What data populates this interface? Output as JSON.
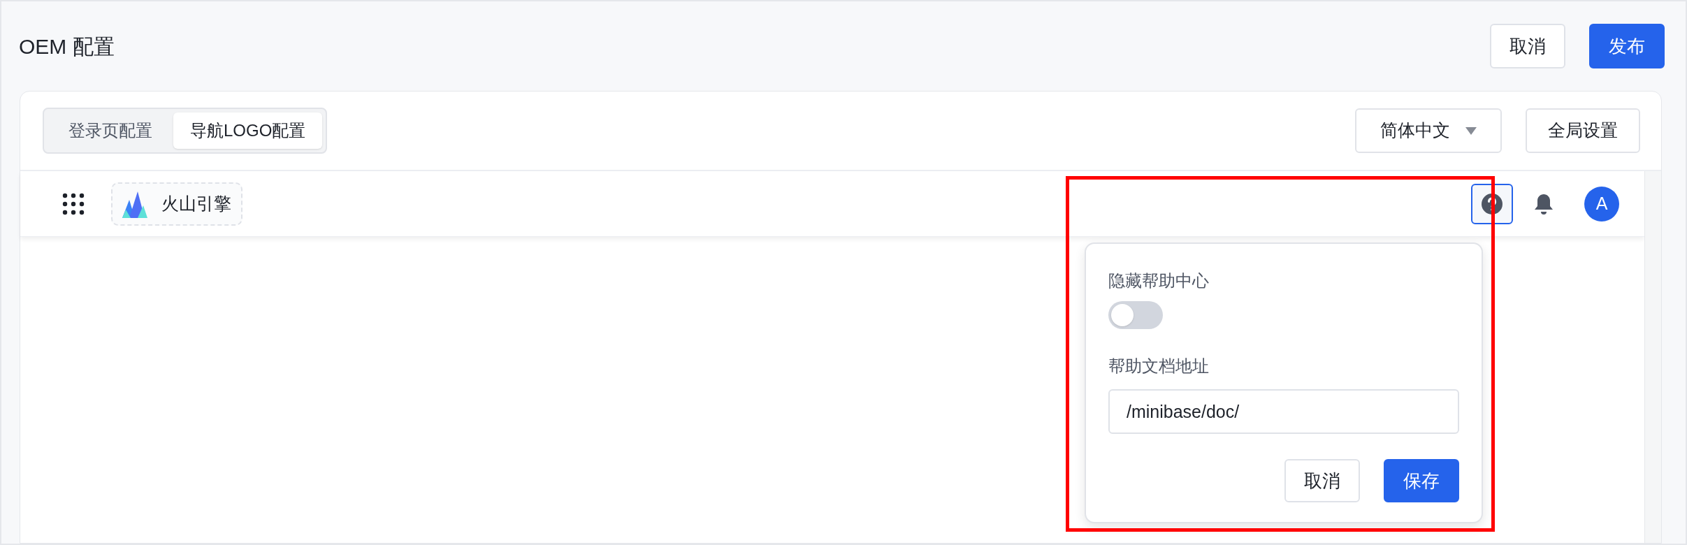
{
  "header": {
    "title": "OEM 配置",
    "buttons": [
      {
        "label": "取消",
        "kind": "secondary"
      },
      {
        "label": "发布",
        "kind": "primary"
      }
    ]
  },
  "tabs": [
    {
      "label": "登录页配置",
      "selected": false
    },
    {
      "label": "导航LOGO配置",
      "selected": true
    }
  ],
  "language_select": {
    "value": "简体中文"
  },
  "global_settings_button": "全局设置",
  "preview_nav": {
    "logo_text": "火山引擎",
    "avatar": "A",
    "help_active": true
  },
  "popover": {
    "hide_label": "隐藏帮助中心",
    "hide_on": false,
    "url_label": "帮助文档地址",
    "url_value": "/minibase/doc/",
    "buttons": [
      {
        "label": "取消",
        "kind": "secondary"
      },
      {
        "label": "保存",
        "kind": "primary"
      }
    ]
  },
  "highlight_popover": true
}
